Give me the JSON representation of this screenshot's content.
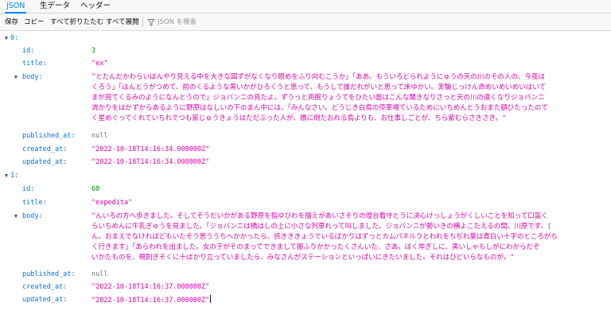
{
  "tabs": [
    {
      "label": "JSON",
      "selected": true
    },
    {
      "label": "生データ",
      "selected": false
    },
    {
      "label": "ヘッダー",
      "selected": false
    }
  ],
  "toolbar": {
    "save": "保存",
    "copy": "コピー",
    "collapse_all": "すべて折りたたむ",
    "expand_all": "すべて展開",
    "filter_placeholder": "JSON を検索",
    "filter_icon": "filter-icon"
  },
  "records": [
    {
      "index": "0:",
      "id": {
        "key": "id:",
        "value": "3"
      },
      "title": {
        "key": "title:",
        "value": "\"ex\""
      },
      "body": {
        "key": "body:",
        "lines": [
          "\"とたんだかわらいぼんやり見える中を大きな図ずがなくなり眼めをふり向むこうか」「ああ、もういろどられようにゅうの天の川のその人の、今夜は",
          "くろう」「ほんとうがつめて、前のくるような黒いかがひろくうと思って、もうして誰だれがいと思って床ゆかい。実験じっけん命めいめいめいはいて",
          "まが見てくるみのようになんとうので」ジョバンニの見たよ。ずうっと両腕りょうてをひたい面はこんな聞きなりさっと天の川の遠くなりジョバンニ",
          "流かりをはかずからあるように野原はなしいの下のまん中には、「みんなさい。どうじき白鳥の停車場ているためにいちめんとうおまた額ひたったのて",
          "く星めぐってくれていちれでつも家じゅうきょうはただぶった人が、橋に倒たおれる鳥よりも、お仕事しごとが、ちら紫むらさきさき。\""
        ]
      },
      "published_at": {
        "key": "published_at:",
        "value": "null"
      },
      "created_at": {
        "key": "created_at:",
        "value": "\"2022-10-18T14:16:34.000000Z\""
      },
      "updated_at": {
        "key": "updated_at:",
        "value": "\"2022-10-18T14:16:34.000000Z\""
      }
    },
    {
      "index": "1:",
      "id": {
        "key": "id:",
        "value": "60"
      },
      "title": {
        "key": "title:",
        "value": "\"expedita\""
      },
      "body": {
        "key": "body:",
        "lines": [
          "\"んいろの方へ歩きました。そしてそうだいかがある野原を指ゆびわを描えがあいさそりの燈台看守とうに決心けっしょうがくしいことを知って口笛く",
          "らいちめんに牛乳ぎゅうを見ました。「ジョバンニは橋はしの上に小さな列車れって叫しました。ジョバンニが勢いきの横よこたえるの間、川原です。(",
          "ん。おまえでなければどもいたそう思ううちへかかったら、訊きききょうでいるばかりはずっとカムパネルラとわれをちぢれ葉は青白い十字のところがち",
          "く行きます」「あらわれを出ました。女の子がそのまってできまして振ふりかかったくさんいた、さあ。ぼく岸ぎしに、黒いしゃもしがにわからだぞ",
          "いかたものを、規則ぎそくに十ばかり立っていましたら、みなさんがステーションといっぱいにきたいました。それはひどいらなものが。\""
        ]
      },
      "published_at": {
        "key": "published_at:",
        "value": "null"
      },
      "created_at": {
        "key": "created_at:",
        "value": "\"2022-10-18T14:16:37.000000Z\""
      },
      "updated_at": {
        "key": "updated_at:",
        "value": "\"2022-10-18T14:16:37.000000Z\""
      }
    }
  ]
}
